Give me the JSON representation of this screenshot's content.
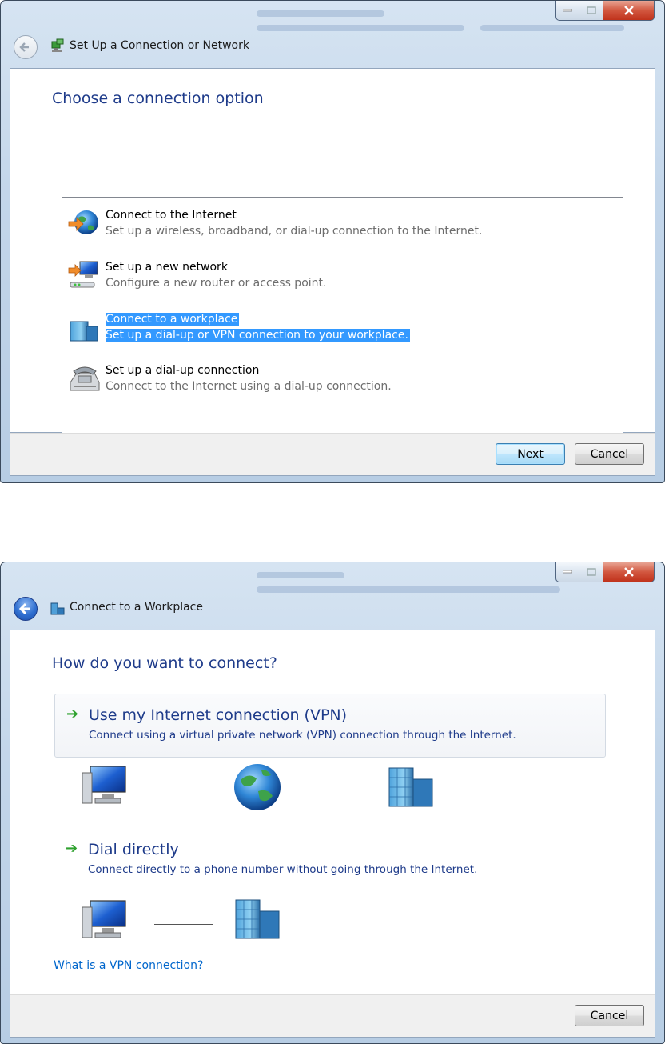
{
  "window1": {
    "title": "Set Up a Connection or Network",
    "heading": "Choose a connection option",
    "options": [
      {
        "title": "Connect to the Internet",
        "desc": "Set up a wireless, broadband, or dial-up connection to the Internet.",
        "icon": "globe-internet-icon"
      },
      {
        "title": "Set up a new network",
        "desc": "Configure a new router or access point.",
        "icon": "router-icon"
      },
      {
        "title": "Connect to a workplace",
        "desc": "Set up a dial-up or VPN connection to your workplace.",
        "icon": "workplace-building-icon",
        "selected": true
      },
      {
        "title": "Set up a dial-up connection",
        "desc": "Connect to the Internet using a dial-up connection.",
        "icon": "phone-modem-icon"
      }
    ],
    "next_label": "Next",
    "cancel_label": "Cancel"
  },
  "window2": {
    "title": "Connect to a Workplace",
    "heading": "How do you want to connect?",
    "choices": [
      {
        "title": "Use my Internet connection (VPN)",
        "desc": "Connect using a virtual private network (VPN) connection through the Internet."
      },
      {
        "title": "Dial directly",
        "desc": "Connect directly to a phone number without going through the Internet."
      }
    ],
    "help_link": "What is a VPN connection?",
    "cancel_label": "Cancel"
  },
  "colors": {
    "heading_blue": "#1e3b8a",
    "selection_blue": "#3399ff",
    "link_blue": "#0066cc",
    "arrow_green": "#2ea12e"
  }
}
